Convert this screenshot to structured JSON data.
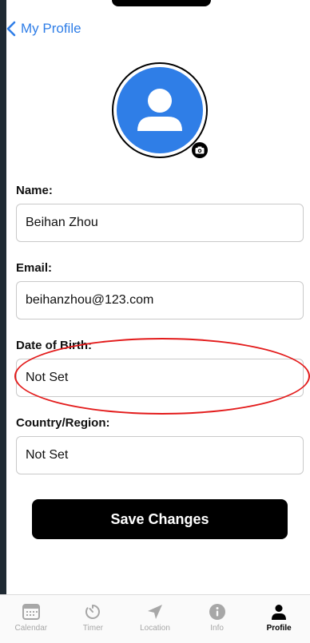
{
  "header": {
    "back_label": "My Profile"
  },
  "profile": {
    "name_label": "Name:",
    "name_value": "Beihan Zhou",
    "email_label": "Email:",
    "email_value": "beihanzhou@123.com",
    "dob_label": "Date of Birth:",
    "dob_value": "Not Set",
    "country_label": "Country/Region:",
    "country_value": "Not Set"
  },
  "actions": {
    "save_label": "Save Changes"
  },
  "tabs": [
    {
      "label": "Calendar",
      "icon": "calendar-icon"
    },
    {
      "label": "Timer",
      "icon": "timer-icon"
    },
    {
      "label": "Location",
      "icon": "location-icon"
    },
    {
      "label": "Info",
      "icon": "info-icon"
    },
    {
      "label": "Profile",
      "icon": "person-icon"
    }
  ],
  "colors": {
    "accent": "#2f7ee7",
    "annotation": "#e31b1b",
    "button": "#000000",
    "inactive_tab": "#a7a7a7"
  },
  "active_tab": "Profile"
}
